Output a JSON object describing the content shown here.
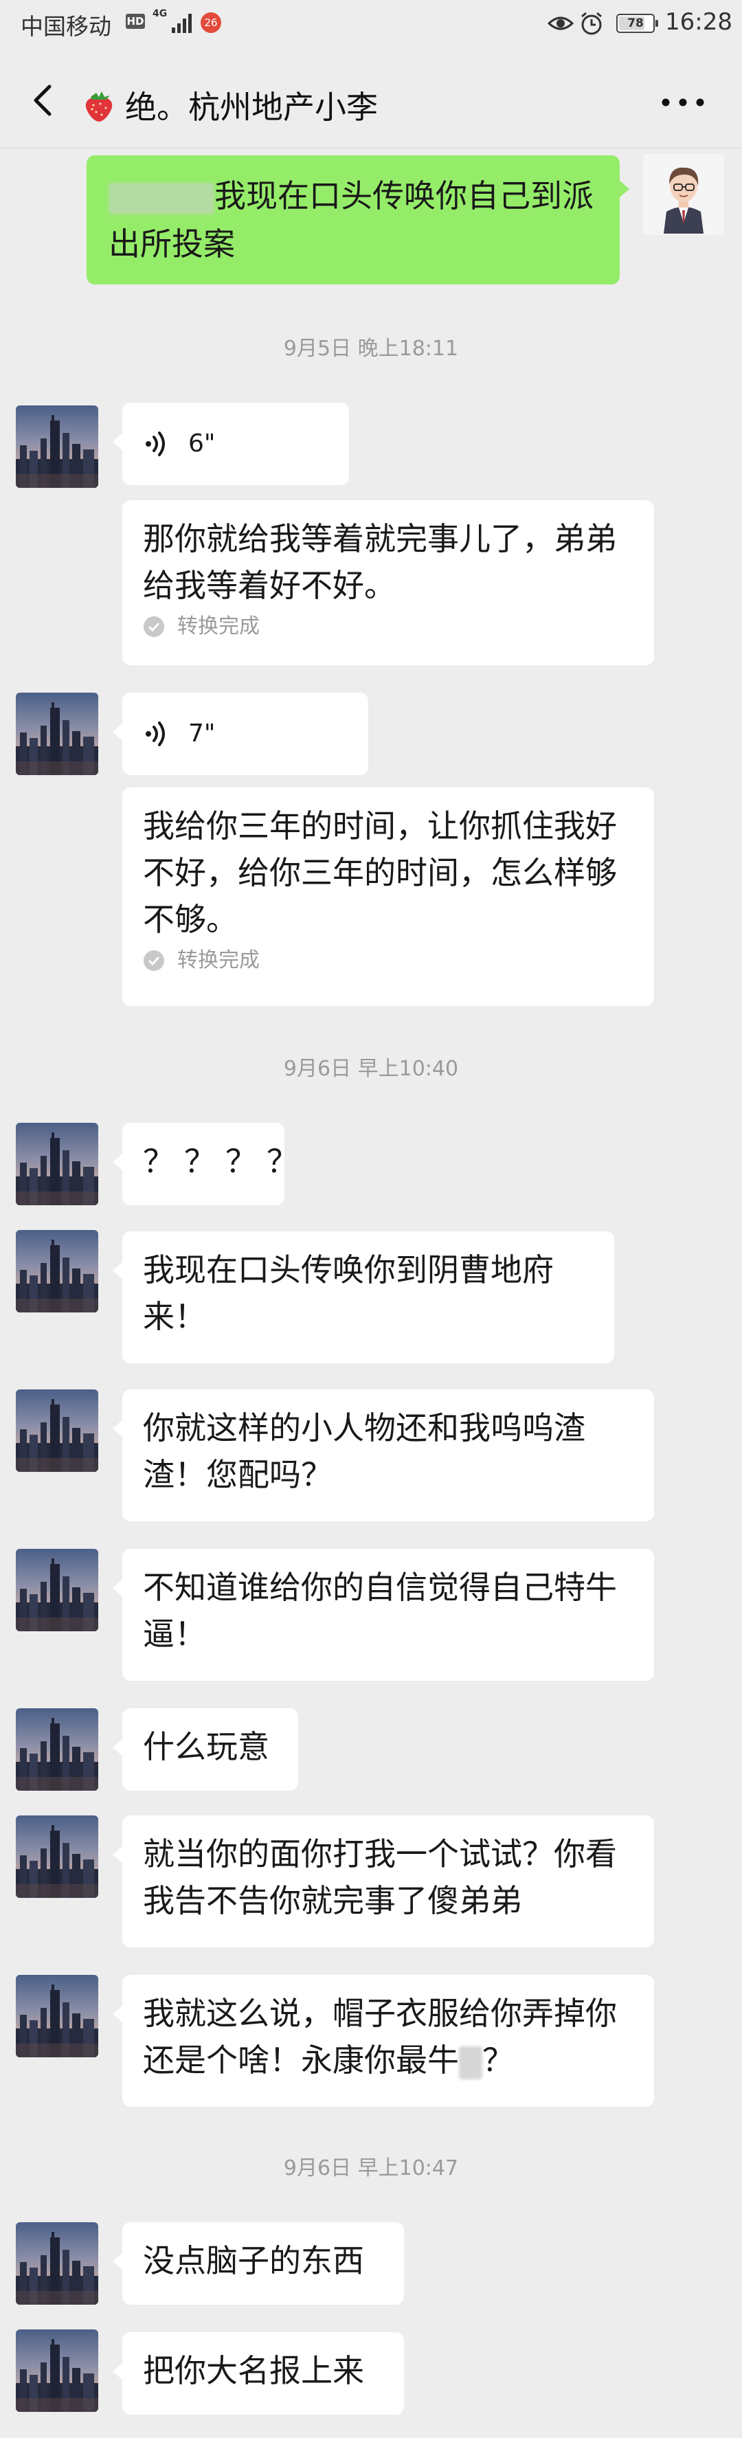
{
  "status_bar": {
    "carrier": "中国移动",
    "hd": "HD",
    "network": "4G",
    "badge": "26",
    "battery": "78",
    "battery_level": 0.78,
    "time": "16:28"
  },
  "nav": {
    "title": "绝。杭州地产小李"
  },
  "messages": {
    "m0": {
      "text": "我现在口头传唤你自己到派出所投案"
    },
    "ts1": "9月5日 晚上18:11",
    "v1": {
      "duration": "6\"",
      "transcript": "那你就给我等着就完事儿了，弟弟给我等着好不好。",
      "status": "转换完成"
    },
    "v2": {
      "duration": "7\"",
      "transcript": "我给你三年的时间，让你抓住我好不好，给你三年的时间，怎么样够不够。",
      "status": "转换完成"
    },
    "ts2": "9月6日 早上10:40",
    "t1": "？？？？",
    "t2": "我现在口头传唤你到阴曹地府来！",
    "t3": "你就这样的小人物还和我呜呜渣渣！您配吗？",
    "t4": "不知道谁给你的自信觉得自己特牛逼！",
    "t5": "什么玩意",
    "t6": "就当你的面你打我一个试试？你看我告不告你就完事了傻弟弟",
    "t7a": "我就这么说，帽子衣服给你弄掉你还是个啥！永康你最牛",
    "t7b": "？",
    "ts3": "9月6日 早上10:47",
    "t8": "没点脑子的东西",
    "t9": "把你大名报上来"
  },
  "colors": {
    "background": "#ededed",
    "sent_bubble": "#95ec69",
    "received_bubble": "#ffffff",
    "timestamp": "#9a9a9a"
  },
  "icons": {
    "back": "chevron-left-icon",
    "more": "more-dots-icon",
    "voice": "voice-wave-icon",
    "check": "check-circle-icon"
  }
}
